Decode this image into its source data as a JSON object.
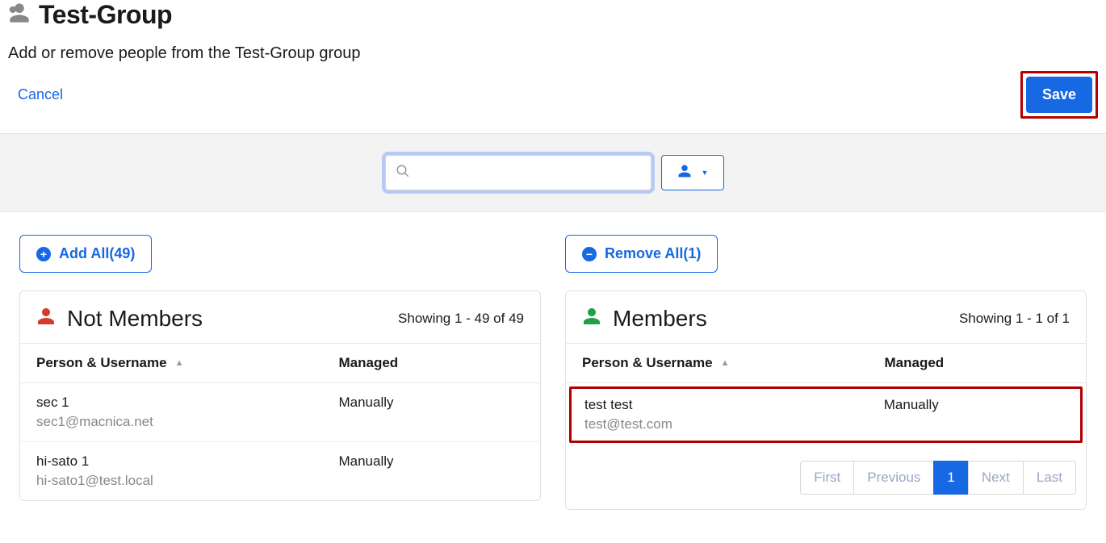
{
  "header": {
    "title": "Test-Group",
    "subtitle": "Add or remove people from the Test-Group group"
  },
  "actions": {
    "cancel": "Cancel",
    "save": "Save"
  },
  "search": {
    "placeholder": ""
  },
  "not_members": {
    "add_all_label": "Add All(49)",
    "title": "Not Members",
    "showing": "Showing 1 - 49 of 49",
    "col_person": "Person & Username",
    "col_managed": "Managed",
    "rows": [
      {
        "name": "sec 1",
        "username": "sec1@macnica.net",
        "managed": "Manually"
      },
      {
        "name": "hi-sato 1",
        "username": "hi-sato1@test.local",
        "managed": "Manually"
      }
    ]
  },
  "members": {
    "remove_all_label": "Remove All(1)",
    "title": "Members",
    "showing": "Showing 1 - 1 of 1",
    "col_person": "Person & Username",
    "col_managed": "Managed",
    "rows": [
      {
        "name": "test test",
        "username": "test@test.com",
        "managed": "Manually"
      }
    ],
    "pager": {
      "first": "First",
      "prev": "Previous",
      "p1": "1",
      "next": "Next",
      "last": "Last"
    }
  }
}
